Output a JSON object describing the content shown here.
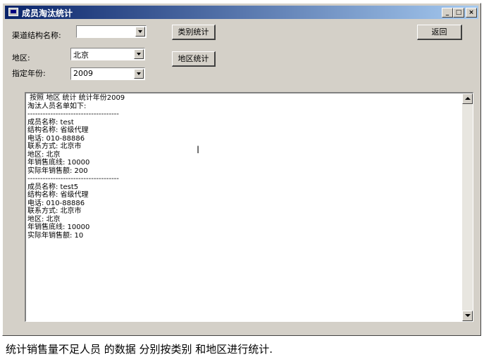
{
  "window": {
    "title": "成员淘汰统计"
  },
  "titlebar_buttons": {
    "minimize": "_",
    "maximize": "□",
    "close": "×"
  },
  "form": {
    "channel_label": "渠道结构名称:",
    "channel_value": "",
    "region_label": "地区:",
    "region_value": "北京",
    "year_label": "指定年份:",
    "year_value": "2009"
  },
  "buttons": {
    "category_stats": "类别统计",
    "region_stats": "地区统计",
    "back": "返回"
  },
  "report": {
    "lines": [
      " 按照 地区 统计 统计年份2009",
      "淘汰人员名单如下:",
      "------------------------------------",
      "成员名称: test",
      "结构名称: 省级代理",
      "电话: 010-88886",
      "联系方式: 北京市",
      "地区: 北京",
      "年销售底线: 10000",
      "实际年销售额: 200",
      "------------------------------------",
      "成员名称: test5",
      "结构名称: 省级代理",
      "电话: 010-88886",
      "联系方式: 北京市",
      "地区: 北京",
      "年销售底线: 10000",
      "实际年销售额: 10"
    ]
  },
  "caption": "统计销售量不足人员 的数据 分别按类别 和地区进行统计."
}
